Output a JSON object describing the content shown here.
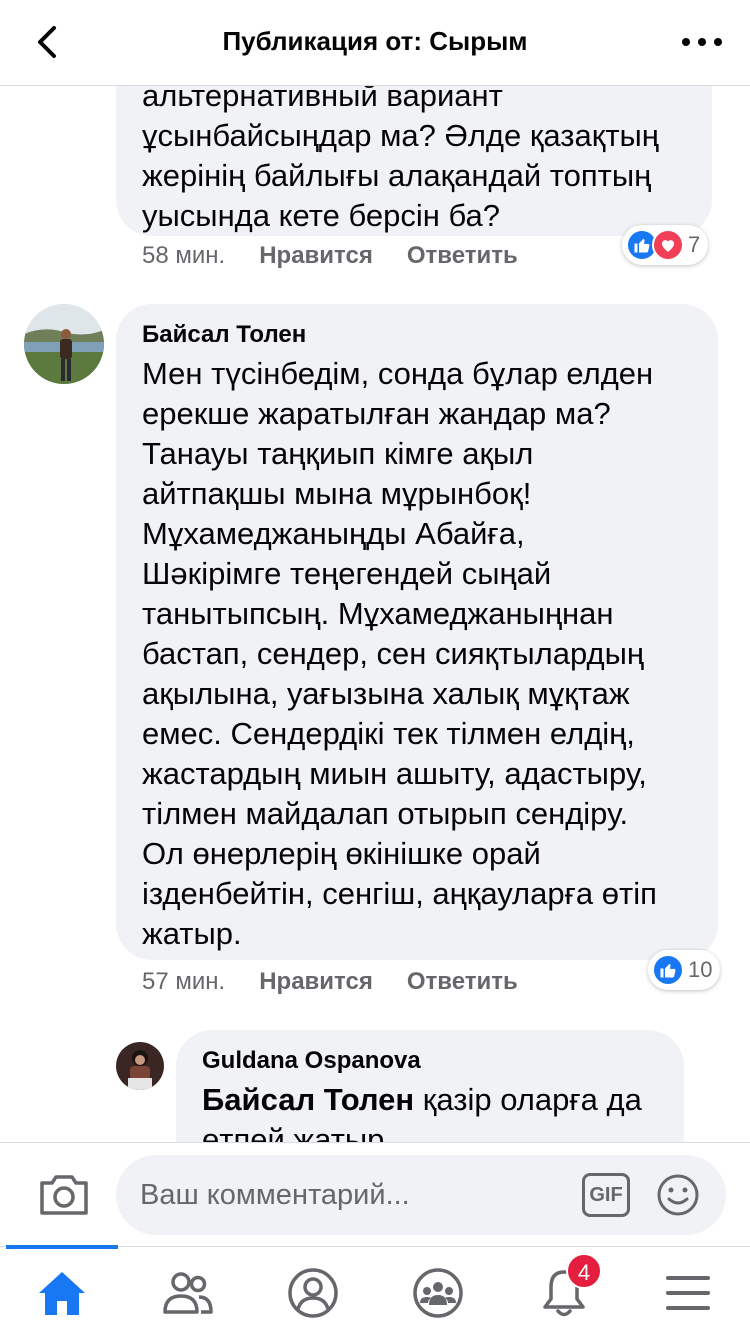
{
  "header": {
    "title": "Публикация от: Сырым"
  },
  "comments": [
    {
      "text_lines": [
        "альтернативный вариант",
        "ұсынбайсыңдар ма? Әлде қазақтың",
        "жерінің байлығы алақандай топтың",
        "уысында кете берсін ба?"
      ],
      "time": "58 мин.",
      "like_label": "Нравится",
      "reply_label": "Ответить",
      "reaction_count": "7"
    },
    {
      "author": "Байсал Толен",
      "text_lines": [
        "Мен түсінбедім, сонда бұлар елден",
        "ерекше жаратылған жандар ма?",
        "Танауы таңқиып кімге ақыл",
        "айтпақшы мына мұрынбоқ!",
        "Мұхамеджаныңды Абайға,",
        "Шәкірімге теңегендей сыңай",
        "танытыпсың. Мұхамеджаныңнан",
        "бастап, сендер, сен сияқтылардың",
        "ақылына, уағызына халық мұқтаж",
        "емес. Сендердікі тек тілмен елдің,",
        "жастардың миын ашыту, адастыру,",
        "тілмен майдалап отырып сендіру.",
        "Ол өнерлерің өкінішке орай",
        "ізденбейтін, сенгіш, аңқауларға өтіп",
        "жатыр."
      ],
      "time": "57 мин.",
      "like_label": "Нравится",
      "reply_label": "Ответить",
      "reaction_count": "10"
    },
    {
      "author": "Guldana Ospanova",
      "mention": "Байсал Толен",
      "text_first": "қазір оларға да",
      "text_second": "өтпей жатыр"
    }
  ],
  "composer": {
    "placeholder": "Ваш комментарий...",
    "gif_label": "GIF"
  },
  "tabbar": {
    "notification_badge": "4"
  },
  "colors": {
    "accent": "#1877f2",
    "bubble": "#f0f2f5",
    "meta_text": "#65676b",
    "badge": "#e41e3f",
    "love": "#f33e58"
  }
}
